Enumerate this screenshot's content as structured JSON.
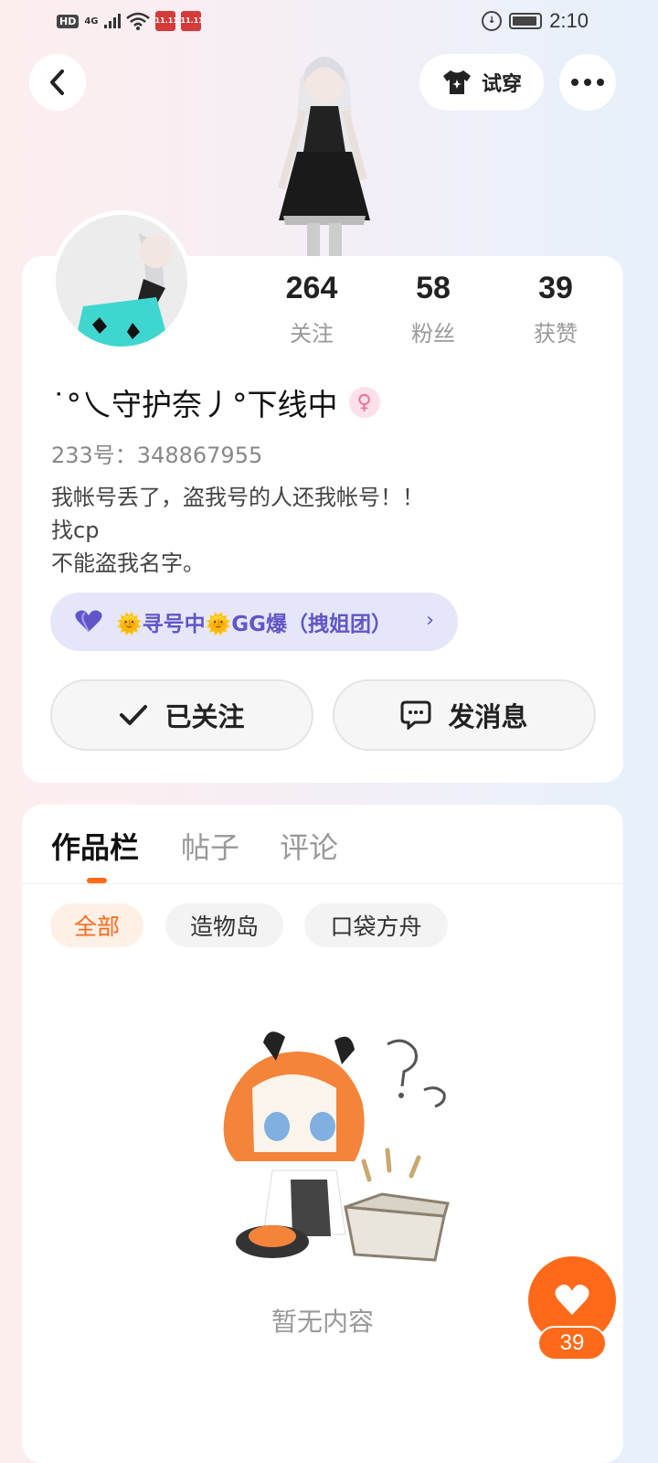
{
  "status_bar": {
    "hd": "HD",
    "network": "4G",
    "shop_badge_1": "11.11",
    "shop_badge_2": "11.11",
    "time": "2:10"
  },
  "header": {
    "tryon_label": "试穿"
  },
  "profile": {
    "stats": [
      {
        "value": "264",
        "label": "关注"
      },
      {
        "value": "58",
        "label": "粉丝"
      },
      {
        "value": "39",
        "label": "获赞"
      }
    ],
    "nickname": "˙°乀守护奈丿°下线中",
    "gender_symbol": "♀",
    "uid": "233号：348867955",
    "bio_lines": [
      "我帐号丢了，盗我号的人还我帐号！！",
      "找cp",
      "不能盗我名字。"
    ],
    "group_label": "🌞寻号中🌞GG爆（拽姐团）",
    "follow_label": "已关注",
    "message_label": "发消息"
  },
  "works": {
    "tabs": [
      "作品栏",
      "帖子",
      "评论"
    ],
    "chips": [
      "全部",
      "造物岛",
      "口袋方舟"
    ],
    "empty_text": "暂无内容"
  },
  "like_fab": {
    "count": "39"
  },
  "colors": {
    "accent": "#ff6a1a",
    "group_text": "#6255c8",
    "group_bg": "#e6e6fb"
  }
}
